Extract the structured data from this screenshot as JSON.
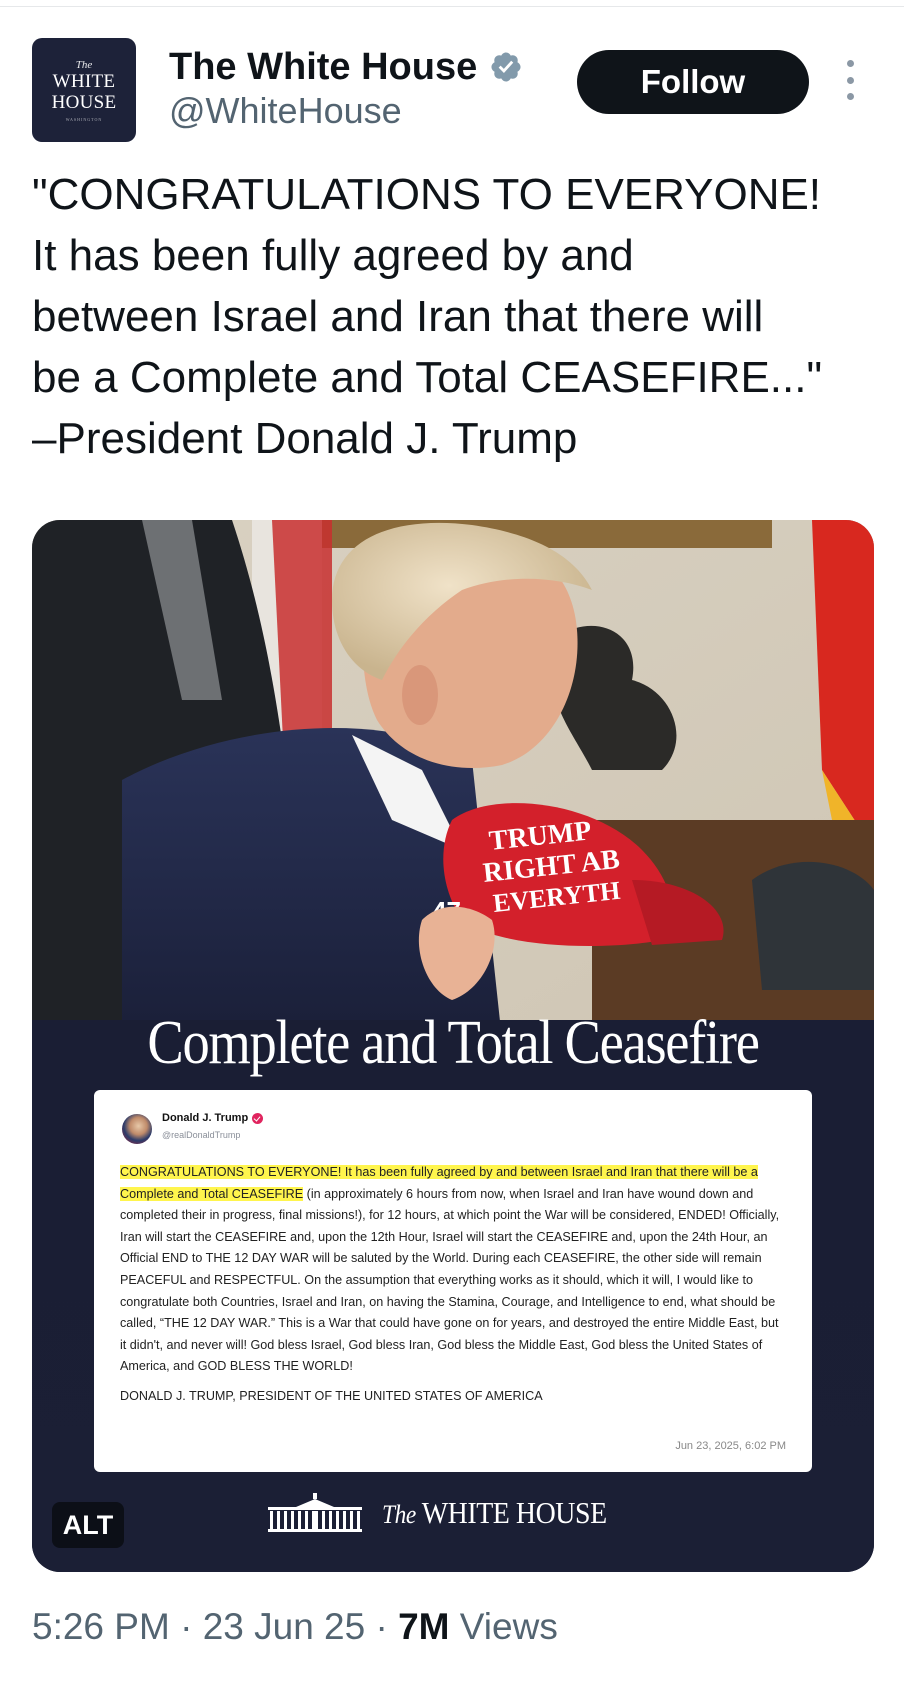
{
  "author": {
    "avatar": {
      "the": "The",
      "line1": "WHITE",
      "line2": "HOUSE",
      "sub": "WASHINGTON"
    },
    "display_name": "The White House",
    "handle": "@WhiteHouse",
    "verified_icon": "verified-badge-icon",
    "verified_color": "#829aab"
  },
  "actions": {
    "follow_label": "Follow",
    "more_icon": "more-vertical-icon"
  },
  "tweet": {
    "text": "\"CONGRATULATIONS TO EVERYONE!\nIt has been fully agreed by and\nbetween Israel and Iran that there will\nbe a Complete and Total CEASEFIRE...\"\n–President Donald J. Trump"
  },
  "media": {
    "headline": "Complete and Total Ceasefire",
    "hat_text": "TRUMP WAS RIGHT ABOUT EVERYTHING",
    "alt_label": "ALT",
    "footer_logo": {
      "the": "The",
      "name": "WHITE HOUSE"
    },
    "inner_post": {
      "name": "Donald J. Trump",
      "handle": "@realDonaldTrump",
      "highlighted": "CONGRATULATIONS TO EVERYONE! It has been fully agreed by and between Israel and Iran that there will be a Complete and Total CEASEFIRE",
      "body": " (in approximately 6 hours from now, when Israel and Iran have wound down and completed their in progress, final missions!), for 12 hours, at which point the War will be considered, ENDED! Officially, Iran will start the CEASEFIRE and, upon the 12th Hour, Israel will start the CEASEFIRE and, upon the 24th Hour, an Official END to THE 12 DAY WAR will be saluted by the World. During each CEASEFIRE, the other side will remain PEACEFUL and RESPECTFUL. On the assumption that everything works as it should, which it will, I would like to congratulate both Countries, Israel and Iran, on having the Stamina, Courage, and Intelligence to end, what should be called, “THE 12 DAY WAR.” This is a War that could have gone on for years, and destroyed the entire Middle East, but it didn't, and never will! God bless Israel, God bless Iran, God bless the Middle East, God bless the United States of America, and GOD BLESS THE WORLD!",
      "signature": "DONALD J. TRUMP, PRESIDENT OF THE UNITED STATES OF AMERICA",
      "date": "Jun 23, 2025, 6:02 PM"
    }
  },
  "meta": {
    "time": "5:26 PM",
    "separator": "·",
    "date": "23 Jun 25",
    "views_count": "7M",
    "views_label": "Views"
  }
}
